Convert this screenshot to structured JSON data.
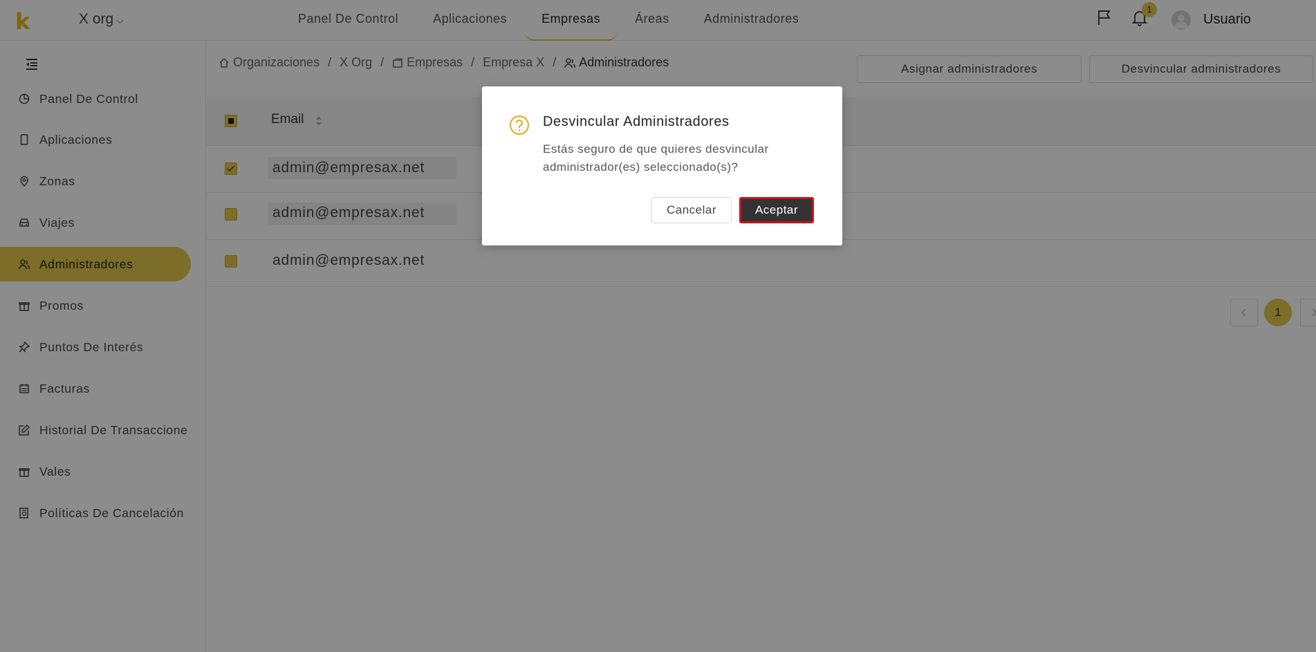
{
  "header": {
    "logo": "k",
    "org_switch": "X org",
    "nav": [
      "Panel De Control",
      "Aplicaciones",
      "Empresas",
      "Áreas",
      "Administradores"
    ],
    "active_nav": "Empresas",
    "notification_count": "1",
    "user_name": "Usuario"
  },
  "sidebar": {
    "items": [
      {
        "label": "Panel De Control",
        "icon": "pie-chart-icon"
      },
      {
        "label": "Aplicaciones",
        "icon": "mobile-icon"
      },
      {
        "label": "Zonas",
        "icon": "location-icon"
      },
      {
        "label": "Viajes",
        "icon": "car-icon"
      },
      {
        "label": "Administradores",
        "icon": "users-icon"
      },
      {
        "label": "Promos",
        "icon": "gift-icon"
      },
      {
        "label": "Puntos De Interés",
        "icon": "pin-icon"
      },
      {
        "label": "Facturas",
        "icon": "invoice-icon"
      },
      {
        "label": "Historial De Transaccione",
        "icon": "edit-icon"
      },
      {
        "label": "Vales",
        "icon": "gift-icon"
      },
      {
        "label": "Políticas De Cancelación",
        "icon": "policy-icon"
      }
    ],
    "active": "Administradores"
  },
  "breadcrumb": {
    "items": [
      "Organizaciones",
      "X Org",
      "Empresas",
      "Empresa X",
      "Administradores"
    ],
    "separator": "/"
  },
  "actions": {
    "assign": "Asignar administradores",
    "unlink": "Desvincular administradores"
  },
  "table": {
    "columns": [
      "Email"
    ],
    "rows": [
      {
        "email": "admin@empresax.net",
        "checked": true
      },
      {
        "email": "admin@empresax.net",
        "checked": true
      },
      {
        "email": "admin@empresax.net",
        "checked": true
      }
    ]
  },
  "pagination": {
    "current_page": "1"
  },
  "modal": {
    "title": "Desvincular Administradores",
    "message": "Estás seguro de que quieres desvincular administrador(es) seleccionado(s)?",
    "cancel": "Cancelar",
    "accept": "Aceptar"
  },
  "colors": {
    "accent": "#e2c84a",
    "highlight_border": "#d0101a"
  }
}
